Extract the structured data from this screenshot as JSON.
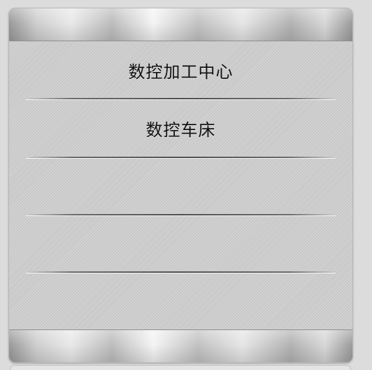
{
  "menu": {
    "items": [
      {
        "label": "数控加工中心"
      },
      {
        "label": "数控车床"
      },
      {
        "label": ""
      },
      {
        "label": ""
      },
      {
        "label": ""
      }
    ]
  }
}
